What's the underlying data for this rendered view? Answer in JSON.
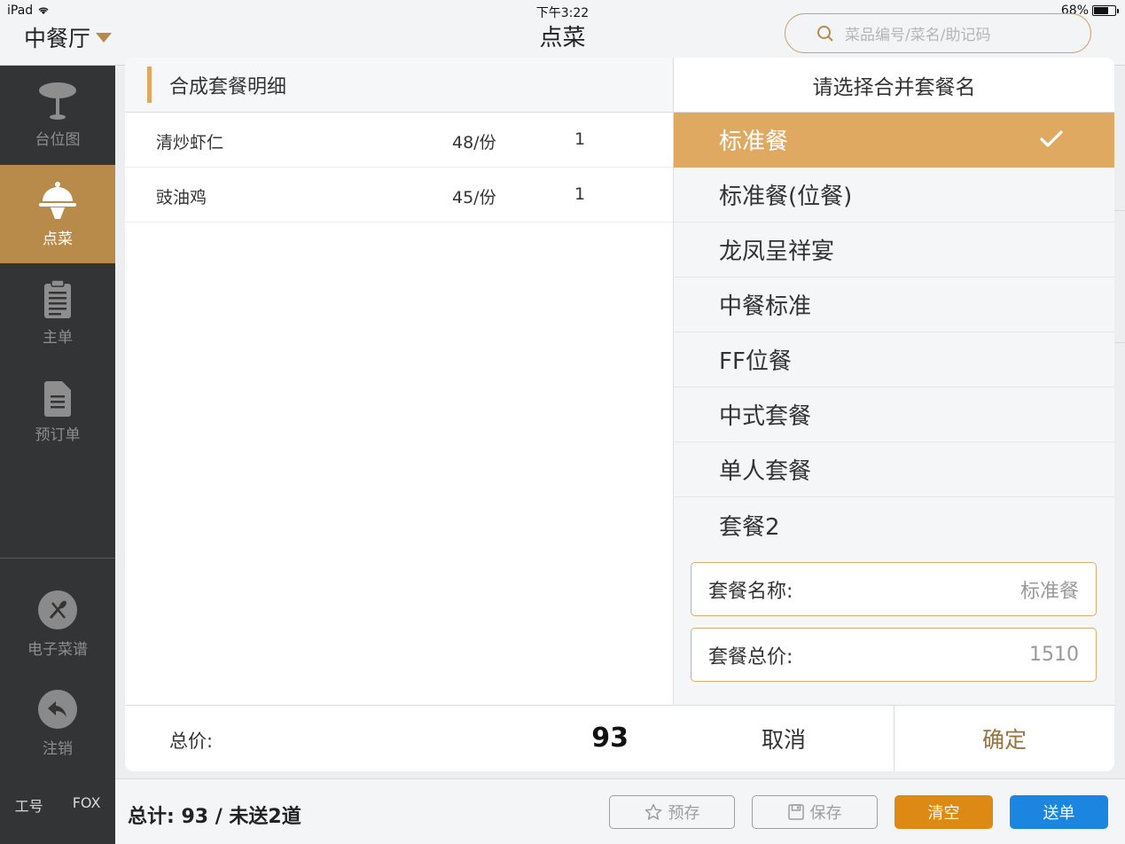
{
  "status_bar": {
    "device": "iPad",
    "time": "下午3:22",
    "battery": "68%",
    "battery_level": 0.68
  },
  "header": {
    "restaurant": "中餐厅",
    "title": "点菜",
    "search_placeholder": "菜品编号/菜名/助记码"
  },
  "sidebar": {
    "items": [
      {
        "label": "台位图",
        "icon": "table-icon"
      },
      {
        "label": "点菜",
        "icon": "serving-cloche-icon"
      },
      {
        "label": "主单",
        "icon": "clipboard-icon"
      },
      {
        "label": "预订单",
        "icon": "document-icon"
      }
    ],
    "menu_label": "电子菜谱",
    "logout_label": "注销",
    "staff_label": "工号",
    "staff_name": "FOX"
  },
  "detail": {
    "title": "合成套餐明细",
    "dishes": [
      {
        "name": "清炒虾仁",
        "price": "48/份",
        "qty": "1"
      },
      {
        "name": "豉油鸡",
        "price": "45/份",
        "qty": "1"
      }
    ],
    "total_label": "总价:",
    "total_value": "93"
  },
  "package_select": {
    "title": "请选择合并套餐名",
    "options": [
      "标准餐",
      "标准餐(位餐)",
      "龙凤呈祥宴",
      "中餐标准",
      "FF位餐",
      "中式套餐",
      "单人套餐",
      "套餐2"
    ],
    "selected": "标准餐",
    "name_label": "套餐名称:",
    "name_value": "标准餐",
    "price_label": "套餐总价:",
    "price_value": "1510",
    "cancel_label": "取消",
    "confirm_label": "确定"
  },
  "bottom_bar": {
    "summary": "总计: 93 / 未送2道",
    "prestore_label": "预存",
    "save_label": "保存",
    "clear_label": "清空",
    "send_label": "送单"
  },
  "colors": {
    "accent": "#e0a962",
    "sidebar_active": "#b98b4b",
    "clear": "#dc8a13",
    "send": "#1a86e0"
  }
}
